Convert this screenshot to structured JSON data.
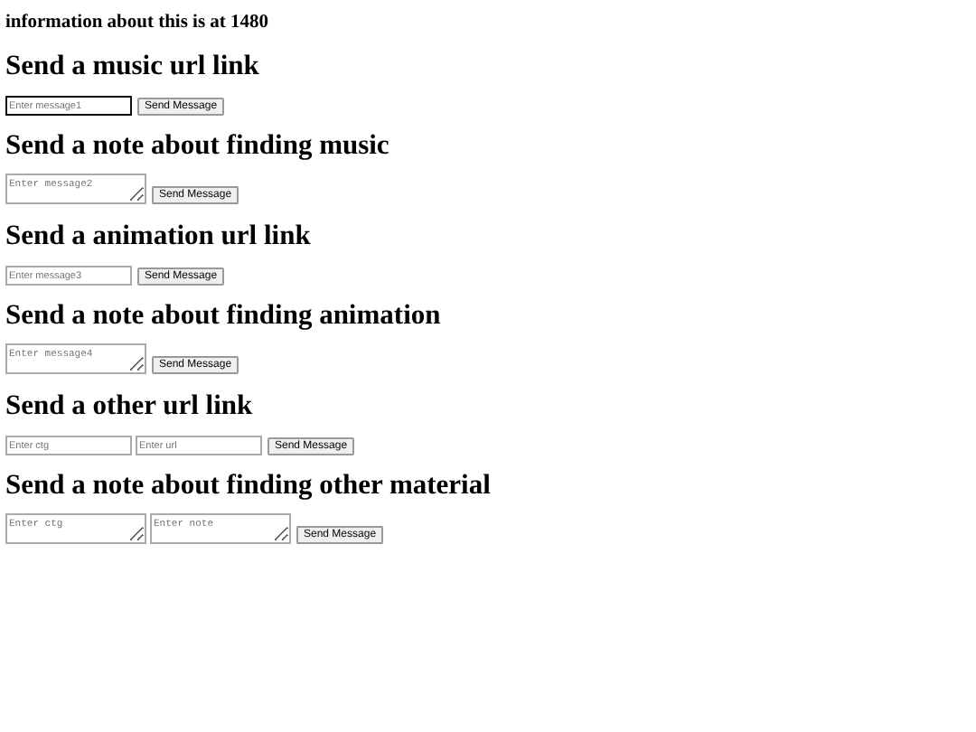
{
  "info": "information about this is at 1480",
  "forms": [
    {
      "heading": "Send a music url link",
      "fields": [
        {
          "kind": "input",
          "placeholder": "Enter message1",
          "focused": true
        }
      ],
      "button": "Send Message"
    },
    {
      "heading": "Send a note about finding music",
      "fields": [
        {
          "kind": "textarea",
          "placeholder": "Enter message2",
          "focused": false
        }
      ],
      "button": "Send Message"
    },
    {
      "heading": "Send a animation url link",
      "fields": [
        {
          "kind": "input",
          "placeholder": "Enter message3",
          "focused": false
        }
      ],
      "button": "Send Message"
    },
    {
      "heading": "Send a note about finding animation",
      "fields": [
        {
          "kind": "textarea",
          "placeholder": "Enter message4",
          "focused": false
        }
      ],
      "button": "Send Message"
    },
    {
      "heading": "Send a other url link",
      "fields": [
        {
          "kind": "input",
          "placeholder": "Enter ctg",
          "focused": false
        },
        {
          "kind": "input",
          "placeholder": "Enter url",
          "focused": false
        }
      ],
      "button": "Send Message"
    },
    {
      "heading": "Send a note about finding other material",
      "fields": [
        {
          "kind": "textarea",
          "placeholder": "Enter ctg",
          "focused": false
        },
        {
          "kind": "textarea",
          "placeholder": "Enter note",
          "focused": false
        }
      ],
      "button": "Send Message"
    }
  ]
}
